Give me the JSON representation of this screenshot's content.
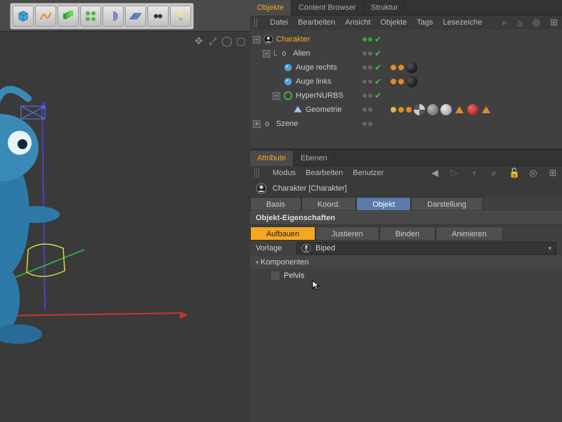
{
  "toolbar_icons": [
    "cube",
    "spline",
    "array",
    "cloner",
    "boole",
    "floor",
    "eyes",
    "light"
  ],
  "viewport_icons": [
    "move",
    "home",
    "frame",
    "maximize"
  ],
  "objects": {
    "tabs": [
      "Objekte",
      "Content Browser",
      "Struktur"
    ],
    "active_tab": 0,
    "menu": [
      "Datei",
      "Bearbeiten",
      "Ansicht",
      "Objekte",
      "Tags",
      "Lesezeiche"
    ],
    "tree": [
      {
        "name": "Charakter",
        "depth": 0,
        "exp": "-",
        "icon": "char",
        "sel": true,
        "vis": [
          "g",
          "g"
        ],
        "check": true,
        "tags": []
      },
      {
        "name": "Alien",
        "depth": 1,
        "exp": "-",
        "icon": "null",
        "vis": [
          "d",
          "d"
        ],
        "check": true,
        "tags": []
      },
      {
        "name": "Auge rechts",
        "depth": 2,
        "icon": "sphere",
        "vis": [
          "d",
          "d"
        ],
        "check": true,
        "tags": [
          "orange",
          "orange",
          "black"
        ]
      },
      {
        "name": "Auge links",
        "depth": 2,
        "icon": "sphere",
        "vis": [
          "d",
          "d"
        ],
        "check": true,
        "tags": [
          "orange",
          "orange",
          "black"
        ]
      },
      {
        "name": "HyperNURBS",
        "depth": 2,
        "exp": "-",
        "icon": "hnurbs",
        "vis": [
          "d",
          "d"
        ],
        "check": true,
        "tags": []
      },
      {
        "name": "Geometrie",
        "depth": 3,
        "icon": "poly",
        "vis": [
          "d",
          "d"
        ],
        "check": false,
        "tags": [
          "gold",
          "orange",
          "orange",
          "checker",
          "grey",
          "silver",
          "otri",
          "red",
          "otri"
        ]
      },
      {
        "name": "Szene",
        "depth": 0,
        "exp": "+",
        "icon": "null",
        "vis": [
          "d",
          "d"
        ],
        "check": false,
        "tags": []
      }
    ]
  },
  "attributes": {
    "tabs": [
      "Attribute",
      "Ebenen"
    ],
    "active_tab": 0,
    "menu": [
      "Modus",
      "Bearbeiten",
      "Benutzer"
    ],
    "title": "Charakter [Charakter]",
    "main_tabs": [
      "Basis",
      "Koord.",
      "Objekt",
      "Darstellung"
    ],
    "main_active": 2,
    "section": "Objekt-Eigenschaften",
    "sub_tabs": [
      "Aufbauen",
      "Justieren",
      "Binden",
      "Animieren"
    ],
    "sub_active": 0,
    "template_label": "Vorlage",
    "template_value": "Biped",
    "components_label": "Komponenten",
    "component_item": "Pelvis"
  },
  "colors": {
    "accent": "#f5a623",
    "blue": "#5a7aa8"
  }
}
